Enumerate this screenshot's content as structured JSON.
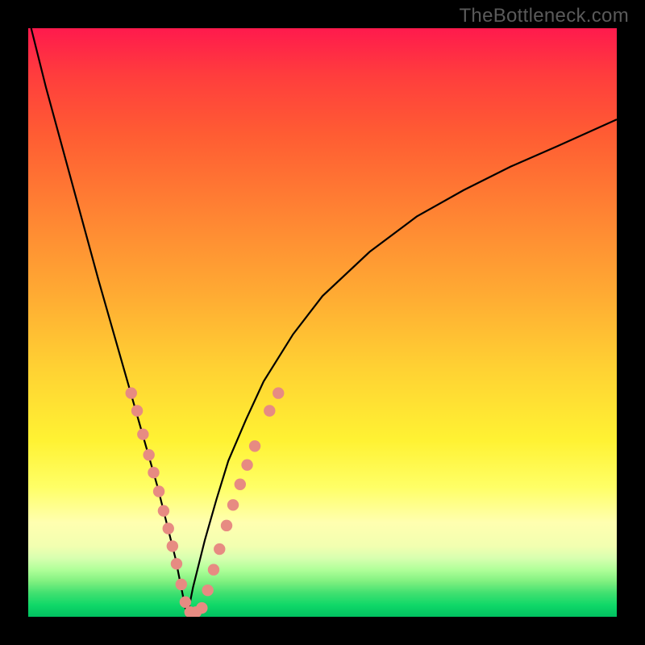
{
  "watermark": "TheBottleneck.com",
  "colors": {
    "curve_stroke": "#000000",
    "dot_fill": "#e78b82",
    "dot_stroke": "#d6766e"
  },
  "chart_data": {
    "type": "line",
    "title": "",
    "xlabel": "",
    "ylabel": "",
    "x_range": [
      0,
      100
    ],
    "y_range": [
      0,
      100
    ],
    "description": "V-shaped bottleneck curve. Minimum (0%) near x≈27. Left branch rises steeply to 100% as x→0. Right branch rises more gradually to ≈85% at x=100. Background gradient maps y=100 (top) to red and y=0 (bottom) to green.",
    "series": [
      {
        "name": "left-branch",
        "x": [
          0.5,
          3,
          6,
          9,
          12,
          15,
          18,
          20,
          22,
          23.5,
          25,
          26,
          27
        ],
        "y": [
          100,
          90,
          79,
          68,
          57,
          46.5,
          36,
          29,
          22,
          16,
          10,
          5,
          0
        ]
      },
      {
        "name": "right-branch",
        "x": [
          27,
          28,
          30,
          32,
          34,
          37,
          40,
          45,
          50,
          58,
          66,
          74,
          82,
          90,
          100
        ],
        "y": [
          0,
          5,
          13,
          20,
          26.5,
          33.5,
          40,
          48,
          54.5,
          62,
          68,
          72.5,
          76.5,
          80,
          84.5
        ]
      }
    ],
    "sample_dots": [
      {
        "x": 17.5,
        "y": 38
      },
      {
        "x": 18.5,
        "y": 35
      },
      {
        "x": 19.5,
        "y": 31
      },
      {
        "x": 20.5,
        "y": 27.5
      },
      {
        "x": 21.3,
        "y": 24.5
      },
      {
        "x": 22.2,
        "y": 21.3
      },
      {
        "x": 23.0,
        "y": 18
      },
      {
        "x": 23.8,
        "y": 15
      },
      {
        "x": 24.5,
        "y": 12
      },
      {
        "x": 25.2,
        "y": 9
      },
      {
        "x": 26.0,
        "y": 5.5
      },
      {
        "x": 26.7,
        "y": 2.5
      },
      {
        "x": 27.5,
        "y": 0.8
      },
      {
        "x": 28.5,
        "y": 0.8
      },
      {
        "x": 29.5,
        "y": 1.5
      },
      {
        "x": 30.5,
        "y": 4.5
      },
      {
        "x": 31.5,
        "y": 8
      },
      {
        "x": 32.5,
        "y": 11.5
      },
      {
        "x": 33.7,
        "y": 15.5
      },
      {
        "x": 34.8,
        "y": 19
      },
      {
        "x": 36.0,
        "y": 22.5
      },
      {
        "x": 37.2,
        "y": 25.8
      },
      {
        "x": 38.5,
        "y": 29
      },
      {
        "x": 41.0,
        "y": 35
      },
      {
        "x": 42.5,
        "y": 38
      }
    ]
  }
}
